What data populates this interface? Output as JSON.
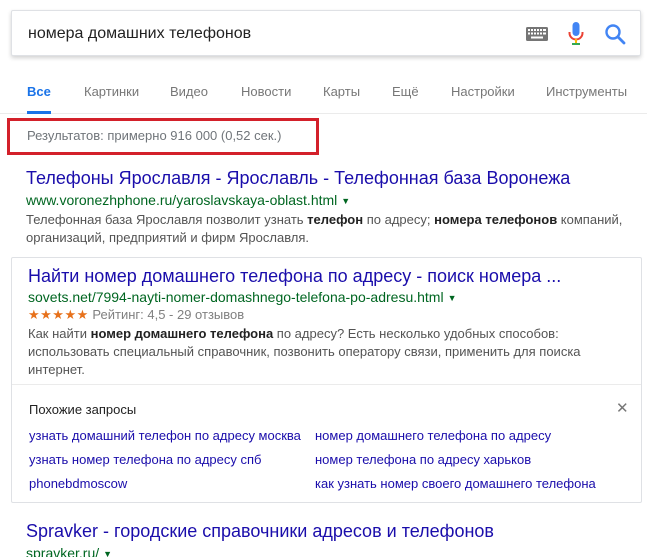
{
  "search": {
    "query": "номера домашних телефонов"
  },
  "tabs": [
    {
      "label": "Все",
      "active": true
    },
    {
      "label": "Картинки"
    },
    {
      "label": "Видео"
    },
    {
      "label": "Новости"
    },
    {
      "label": "Карты"
    },
    {
      "label": "Ещё"
    },
    {
      "label": "Настройки"
    },
    {
      "label": "Инструменты"
    }
  ],
  "stats": "Результатов: примерно 916 000 (0,52 сек.)",
  "highlight_color": "#d3202a",
  "results": [
    {
      "title": "Телефоны Ярославля - Ярославль - Телефонная база Воронежа",
      "url": "www.voronezhphone.ru/yaroslavskaya-oblast.html",
      "snippet_parts": [
        {
          "t": "Телефонная база Ярославля позволит узнать ",
          "b": false
        },
        {
          "t": "телефон",
          "b": true
        },
        {
          "t": " по адресу; ",
          "b": false
        },
        {
          "t": "номера телефонов",
          "b": true
        },
        {
          "t": " компаний, организаций, предприятий и фирм Ярославля.",
          "b": false
        }
      ]
    },
    {
      "title": "Найти номер домашнего телефона по адресу - поиск номера ...",
      "url": "sovets.net/7994-nayti-nomer-domashnego-telefona-po-adresu.html",
      "stars": "★★★★★",
      "rating_text": "Рейтинг: 4,5 - 29 отзывов",
      "snippet_parts": [
        {
          "t": "Как найти ",
          "b": false
        },
        {
          "t": "номер домашнего телефона",
          "b": true
        },
        {
          "t": " по адресу? Есть несколько удобных способов: использовать специальный справочник, позвонить оператору связи, применить для поиска интернет.",
          "b": false
        }
      ]
    },
    {
      "title": "Spravker - городские справочники адресов и телефонов",
      "url": "spravker.ru/"
    }
  ],
  "related": {
    "title": "Похожие запросы",
    "items": [
      "узнать домашний телефон по адресу москва",
      "номер домашнего телефона по адресу",
      "узнать номер телефона по адресу спб",
      "номер телефона по адресу харьков",
      "phonebdmoscow",
      "как узнать номер своего домашнего телефона"
    ]
  },
  "icons": {
    "keyboard": "keyboard-icon",
    "mic": "mic-icon",
    "search": "search-icon",
    "close": "close-icon"
  },
  "colors": {
    "link": "#1a0dab",
    "url": "#006621",
    "tab_active": "#1a73e8",
    "stars": "#e7711b"
  }
}
